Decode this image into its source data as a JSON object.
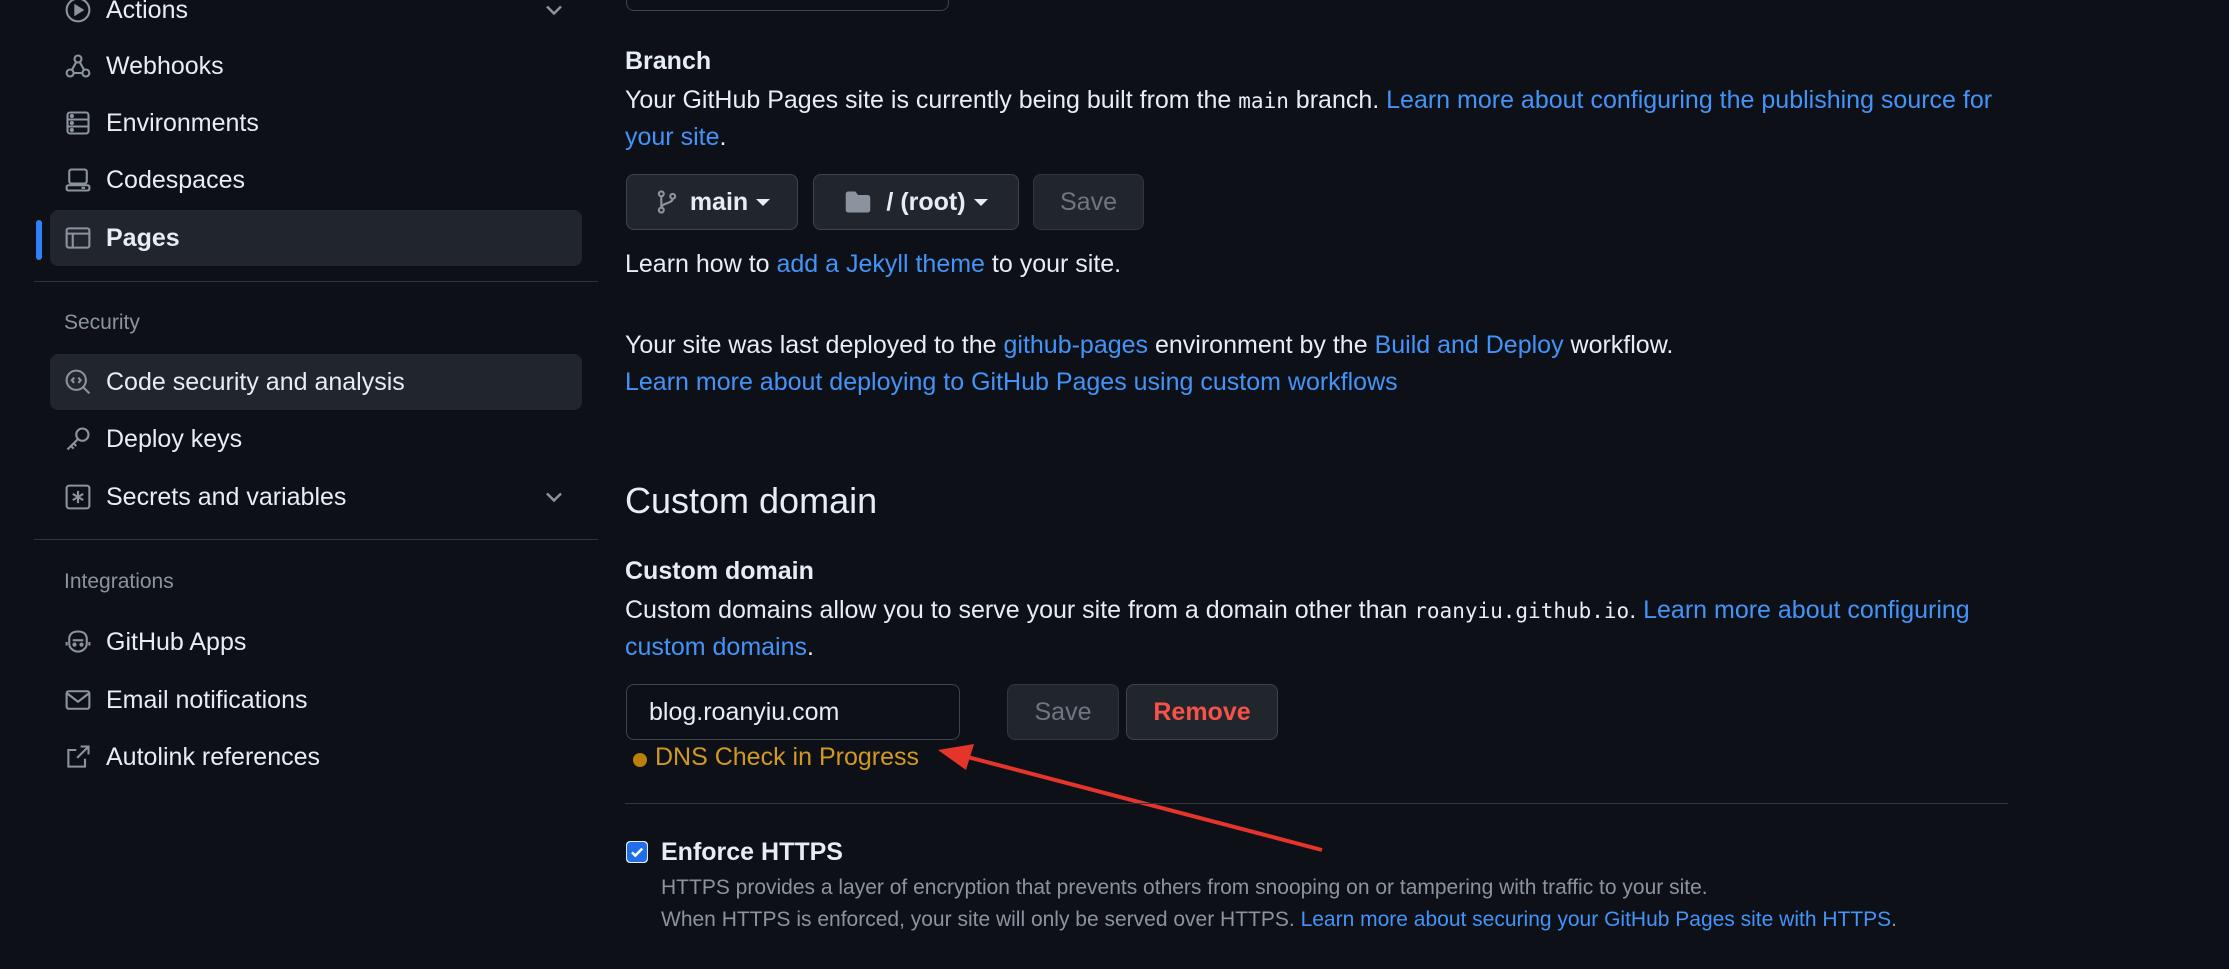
{
  "sidebar": {
    "items_top": [
      {
        "label": "Actions",
        "icon": "play-icon"
      },
      {
        "label": "Webhooks",
        "icon": "webhook-icon"
      },
      {
        "label": "Environments",
        "icon": "server-icon"
      },
      {
        "label": "Codespaces",
        "icon": "codespaces-icon"
      },
      {
        "label": "Pages",
        "icon": "browser-icon"
      }
    ],
    "security_title": "Security",
    "security_items": [
      {
        "label": "Code security and analysis",
        "icon": "codescan-icon"
      },
      {
        "label": "Deploy keys",
        "icon": "key-icon"
      },
      {
        "label": "Secrets and variables",
        "icon": "asterisk-icon"
      }
    ],
    "integrations_title": "Integrations",
    "integration_items": [
      {
        "label": "GitHub Apps",
        "icon": "copilot-icon"
      },
      {
        "label": "Email notifications",
        "icon": "mail-icon"
      },
      {
        "label": "Autolink references",
        "icon": "link-external-icon"
      }
    ]
  },
  "branch": {
    "title": "Branch",
    "desc_prefix": "Your GitHub Pages site is currently being built from the ",
    "desc_branch": "main",
    "desc_suffix": " branch. ",
    "desc_link_1": "Learn more about configuring the publishing source for",
    "desc_link_2": "your site",
    "desc_end": ".",
    "branch_button": "main",
    "folder_button": "/ (root)",
    "save_button": "Save",
    "jekyll_prefix": "Learn how to ",
    "jekyll_link": "add a Jekyll theme",
    "jekyll_suffix": " to your site."
  },
  "deploy": {
    "prefix": "Your site was last deployed to the ",
    "env_link": "github-pages",
    "middle": " environment by the ",
    "workflow_link": "Build and Deploy",
    "suffix": " workflow.",
    "learn_link": "Learn more about deploying to GitHub Pages using custom workflows"
  },
  "custom_domain": {
    "heading": "Custom domain",
    "label": "Custom domain",
    "desc_prefix": "Custom domains allow you to serve your site from a domain other than ",
    "desc_domain": "roanyiu.github.io",
    "desc_sep": ". ",
    "desc_link_1": "Learn more about configuring",
    "desc_link_2": "custom domains",
    "desc_end": ".",
    "input_value": "blog.roanyiu.com",
    "save_button": "Save",
    "remove_button": "Remove",
    "status": "DNS Check in Progress"
  },
  "https": {
    "title": "Enforce HTTPS",
    "line1": "HTTPS provides a layer of encryption that prevents others from snooping on or tampering with traffic to your site.",
    "line2_prefix": "When HTTPS is enforced, your site will only be served over HTTPS. ",
    "line2_link": "Learn more about securing your GitHub Pages site with HTTPS",
    "line2_end": ".",
    "checked": true
  },
  "colors": {
    "background": "#0d1117",
    "link": "#4493f8",
    "accent": "#2f81f7",
    "danger": "#f85149",
    "warning": "#d29922",
    "annotation_arrow": "#e5352b"
  }
}
